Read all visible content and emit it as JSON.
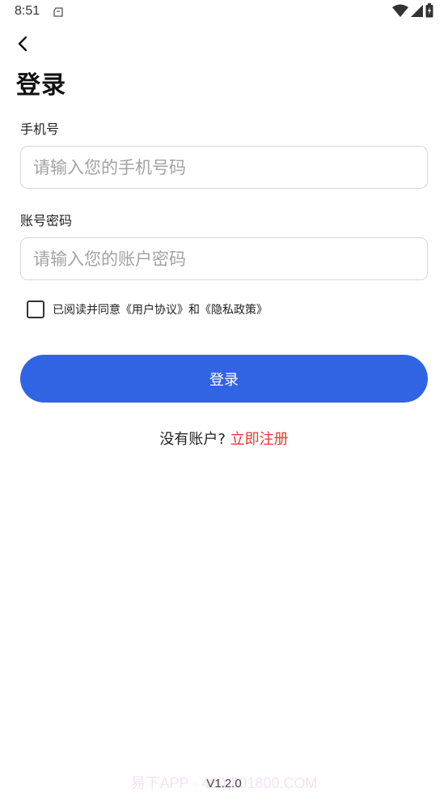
{
  "status_bar": {
    "time": "8:51",
    "icons": [
      "clipboard-icon",
      "wifi-icon",
      "signal-icon",
      "battery-icon"
    ]
  },
  "header": {
    "back_icon": "chevron-left-icon",
    "title": "登录"
  },
  "form": {
    "phone": {
      "label": "手机号",
      "placeholder": "请输入您的手机号码",
      "value": ""
    },
    "password": {
      "label": "账号密码",
      "placeholder": "请输入您的账户密码",
      "value": ""
    },
    "agreement": {
      "checked": false,
      "text": "已阅读并同意《用户协议》和《隐私政策》"
    },
    "login_button": "登录"
  },
  "register": {
    "prompt": "没有账户?",
    "link": "立即注册"
  },
  "footer": {
    "watermark": "易下APP · 400-801800.COM",
    "version": "V1.2.0"
  },
  "colors": {
    "primary": "#3064e2",
    "link": "#ec3535",
    "border": "#d6d6d6"
  }
}
